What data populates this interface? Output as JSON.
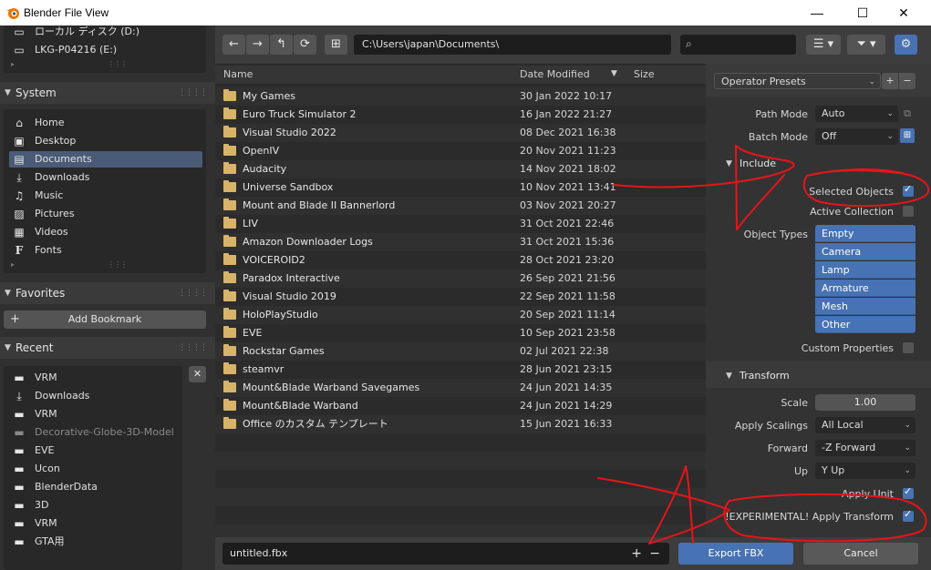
{
  "window": {
    "title": "Blender File View",
    "minimize": "—",
    "maximize": "☐",
    "close": "✕"
  },
  "sidebar": {
    "drives": [
      {
        "label": "ローカル ディスク (D:)",
        "icon": "drive-icon"
      },
      {
        "label": "LKG-P04216 (E:)",
        "icon": "drive-icon"
      }
    ],
    "system": {
      "title": "System",
      "items": [
        {
          "label": "Home",
          "icon": "home-icon"
        },
        {
          "label": "Desktop",
          "icon": "desktop-icon"
        },
        {
          "label": "Documents",
          "icon": "documents-icon",
          "active": true
        },
        {
          "label": "Downloads",
          "icon": "download-icon"
        },
        {
          "label": "Music",
          "icon": "music-icon"
        },
        {
          "label": "Pictures",
          "icon": "pictures-icon"
        },
        {
          "label": "Videos",
          "icon": "videos-icon"
        },
        {
          "label": "Fonts",
          "icon": "fonts-icon"
        }
      ]
    },
    "favorites": {
      "title": "Favorites",
      "add_bookmark": "Add Bookmark"
    },
    "recent": {
      "title": "Recent",
      "items": [
        {
          "label": "VRM",
          "icon": "folder-icon"
        },
        {
          "label": "Downloads",
          "icon": "download-icon"
        },
        {
          "label": "VRM",
          "icon": "folder-icon"
        },
        {
          "label": "Decorative-Globe-3D-Model",
          "icon": "folder-icon",
          "dim": true
        },
        {
          "label": "EVE",
          "icon": "folder-icon"
        },
        {
          "label": "Ucon",
          "icon": "folder-icon"
        },
        {
          "label": "BlenderData",
          "icon": "folder-icon"
        },
        {
          "label": "3D",
          "icon": "folder-icon"
        },
        {
          "label": "VRM",
          "icon": "folder-icon"
        },
        {
          "label": "GTA用",
          "icon": "folder-icon"
        }
      ]
    }
  },
  "toolbar": {
    "path": "C:\\Users\\japan\\Documents\\",
    "search_placeholder": ""
  },
  "filelist": {
    "columns": {
      "name": "Name",
      "date": "Date Modified",
      "size": "Size"
    },
    "rows": [
      {
        "name": "My Games",
        "date": "30 Jan 2022 10:17"
      },
      {
        "name": "Euro Truck Simulator 2",
        "date": "16 Jan 2022 21:27"
      },
      {
        "name": "Visual Studio 2022",
        "date": "08 Dec 2021 16:38"
      },
      {
        "name": "OpenIV",
        "date": "20 Nov 2021 11:23"
      },
      {
        "name": "Audacity",
        "date": "14 Nov 2021 18:02"
      },
      {
        "name": "Universe Sandbox",
        "date": "10 Nov 2021 13:41"
      },
      {
        "name": "Mount and Blade II Bannerlord",
        "date": "03 Nov 2021 20:27"
      },
      {
        "name": "LIV",
        "date": "31 Oct 2021 22:46"
      },
      {
        "name": "Amazon Downloader Logs",
        "date": "31 Oct 2021 15:36"
      },
      {
        "name": "VOICEROID2",
        "date": "28 Oct 2021 23:20"
      },
      {
        "name": "Paradox Interactive",
        "date": "26 Sep 2021 21:56"
      },
      {
        "name": "Visual Studio 2019",
        "date": "22 Sep 2021 11:58"
      },
      {
        "name": "HoloPlayStudio",
        "date": "20 Sep 2021 11:14"
      },
      {
        "name": "EVE",
        "date": "10 Sep 2021 23:58"
      },
      {
        "name": "Rockstar Games",
        "date": "02 Jul 2021 22:38"
      },
      {
        "name": "steamvr",
        "date": "28 Jun 2021 23:15"
      },
      {
        "name": "Mount&Blade Warband Savegames",
        "date": "24 Jun 2021 14:35"
      },
      {
        "name": "Mount&Blade Warband",
        "date": "24 Jun 2021 14:29"
      },
      {
        "name": "Office のカスタム テンプレート",
        "date": "15 Jun 2021 16:33"
      }
    ]
  },
  "settings": {
    "operator_presets": "Operator Presets",
    "path_mode": {
      "label": "Path Mode",
      "value": "Auto"
    },
    "batch_mode": {
      "label": "Batch Mode",
      "value": "Off"
    },
    "include": {
      "title": "Include",
      "selected_objects": {
        "label": "Selected Objects",
        "checked": true
      },
      "active_collection": {
        "label": "Active Collection",
        "checked": false
      },
      "object_types_label": "Object Types",
      "object_types": [
        "Empty",
        "Camera",
        "Lamp",
        "Armature",
        "Mesh",
        "Other"
      ],
      "custom_properties": {
        "label": "Custom Properties",
        "checked": false
      }
    },
    "transform": {
      "title": "Transform",
      "scale": {
        "label": "Scale",
        "value": "1.00"
      },
      "apply_scalings": {
        "label": "Apply Scalings",
        "value": "All Local"
      },
      "forward": {
        "label": "Forward",
        "value": "-Z Forward"
      },
      "up": {
        "label": "Up",
        "value": "Y Up"
      },
      "apply_unit": {
        "label": "Apply Unit",
        "checked": true
      },
      "apply_transform": {
        "label": "!EXPERIMENTAL! Apply Transform",
        "checked": true
      }
    }
  },
  "bottom": {
    "filename": "untitled.fbx",
    "export_label": "Export FBX",
    "cancel_label": "Cancel"
  },
  "colors": {
    "accent": "#4772b3",
    "annotation": "#e8141a",
    "folder": "#d8b46a"
  }
}
